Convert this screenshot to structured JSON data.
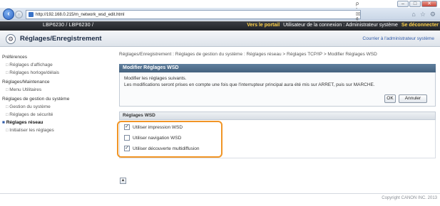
{
  "browser": {
    "url": "http://192.168.0.215/m_network_wsd_edit.html",
    "address_tools": "ρ - ☒ ¢ ✕",
    "window_buttons": [
      "–",
      "□",
      "✕"
    ]
  },
  "device_header": {
    "model": "LBP6230 / LBP6230 /",
    "portal_link": "Vers le portail",
    "user_label": "Utilisateur de la connexion : Administrateur système",
    "logout_link": "Se déconnecter"
  },
  "title_bar": {
    "title": "Réglages/Enregistrement",
    "back_link": "Courrier à l'administrateur système"
  },
  "sidebar": {
    "items": [
      {
        "label": "Préférences",
        "type": "category"
      },
      {
        "label": "Réglages d'affichage",
        "type": "sub"
      },
      {
        "label": "Réglages horloge/délais",
        "type": "sub"
      },
      {
        "label": "Réglages/Maintenance",
        "type": "category"
      },
      {
        "label": "Menu Utilitaires",
        "type": "sub"
      },
      {
        "label": "Réglages de gestion du système",
        "type": "category"
      },
      {
        "label": "Gestion du système",
        "type": "sub"
      },
      {
        "label": "Réglages de sécurité",
        "type": "sub"
      },
      {
        "label": "Réglages réseau",
        "type": "active"
      },
      {
        "label": "Initialiser les réglages",
        "type": "sub"
      }
    ]
  },
  "main": {
    "breadcrumb": "Réglages/Enregistrement : Réglages de gestion du système : Réglages réseau > Réglages TCP/IP > Modifier Réglages WSD",
    "section_title": "Modifier Réglages WSD",
    "desc_line1": "Modifier les réglages suivants.",
    "desc_line2": "Les modifications seront prises en compte une fois que l'interrupteur principal aura été mis sur ARRET, puis sur MARCHE.",
    "ok_label": "OK",
    "cancel_label": "Annuler",
    "settings_header": "Réglages WSD",
    "options": [
      {
        "label": "Utiliser impression WSD",
        "checked": true
      },
      {
        "label": "Utiliser navigation WSD",
        "checked": false
      },
      {
        "label": "Utiliser découverte multidiffusion",
        "checked": true
      }
    ],
    "top_button": "▲"
  },
  "footer": {
    "copyright": "Copyright CANON INC. 2013"
  },
  "colors": {
    "highlight": "#f19526",
    "section_head": "#45627e",
    "header_bg": "#1f2125",
    "link_yellow": "#ffd24a"
  }
}
